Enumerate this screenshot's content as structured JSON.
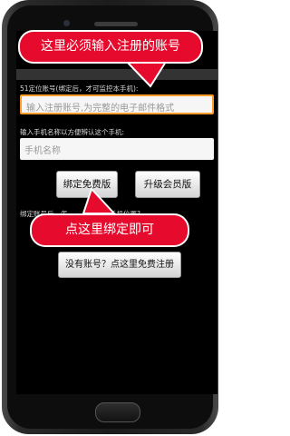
{
  "annotations": {
    "top": "这里必须输入注册的账号",
    "middle": "点这里绑定即可"
  },
  "form": {
    "account_label": "51定位账号(绑定后，才可监控本手机):",
    "account_placeholder": "输入注册账号,为完整的电子邮件格式",
    "name_label": "输入手机名称以方便辨认这个手机:",
    "name_placeholder": "手机名称",
    "bind_button": "绑定免费版",
    "upgrade_button": "升级会员版",
    "hint_prefix": "绑定账号后，怎",
    "hint_suffix": "手机位置?",
    "register_button": "没有账号？点这里免费注册"
  },
  "colors": {
    "annotation_red": "#e60a2d",
    "focus_border": "#ff9d2a",
    "screen_background": "#000000"
  }
}
